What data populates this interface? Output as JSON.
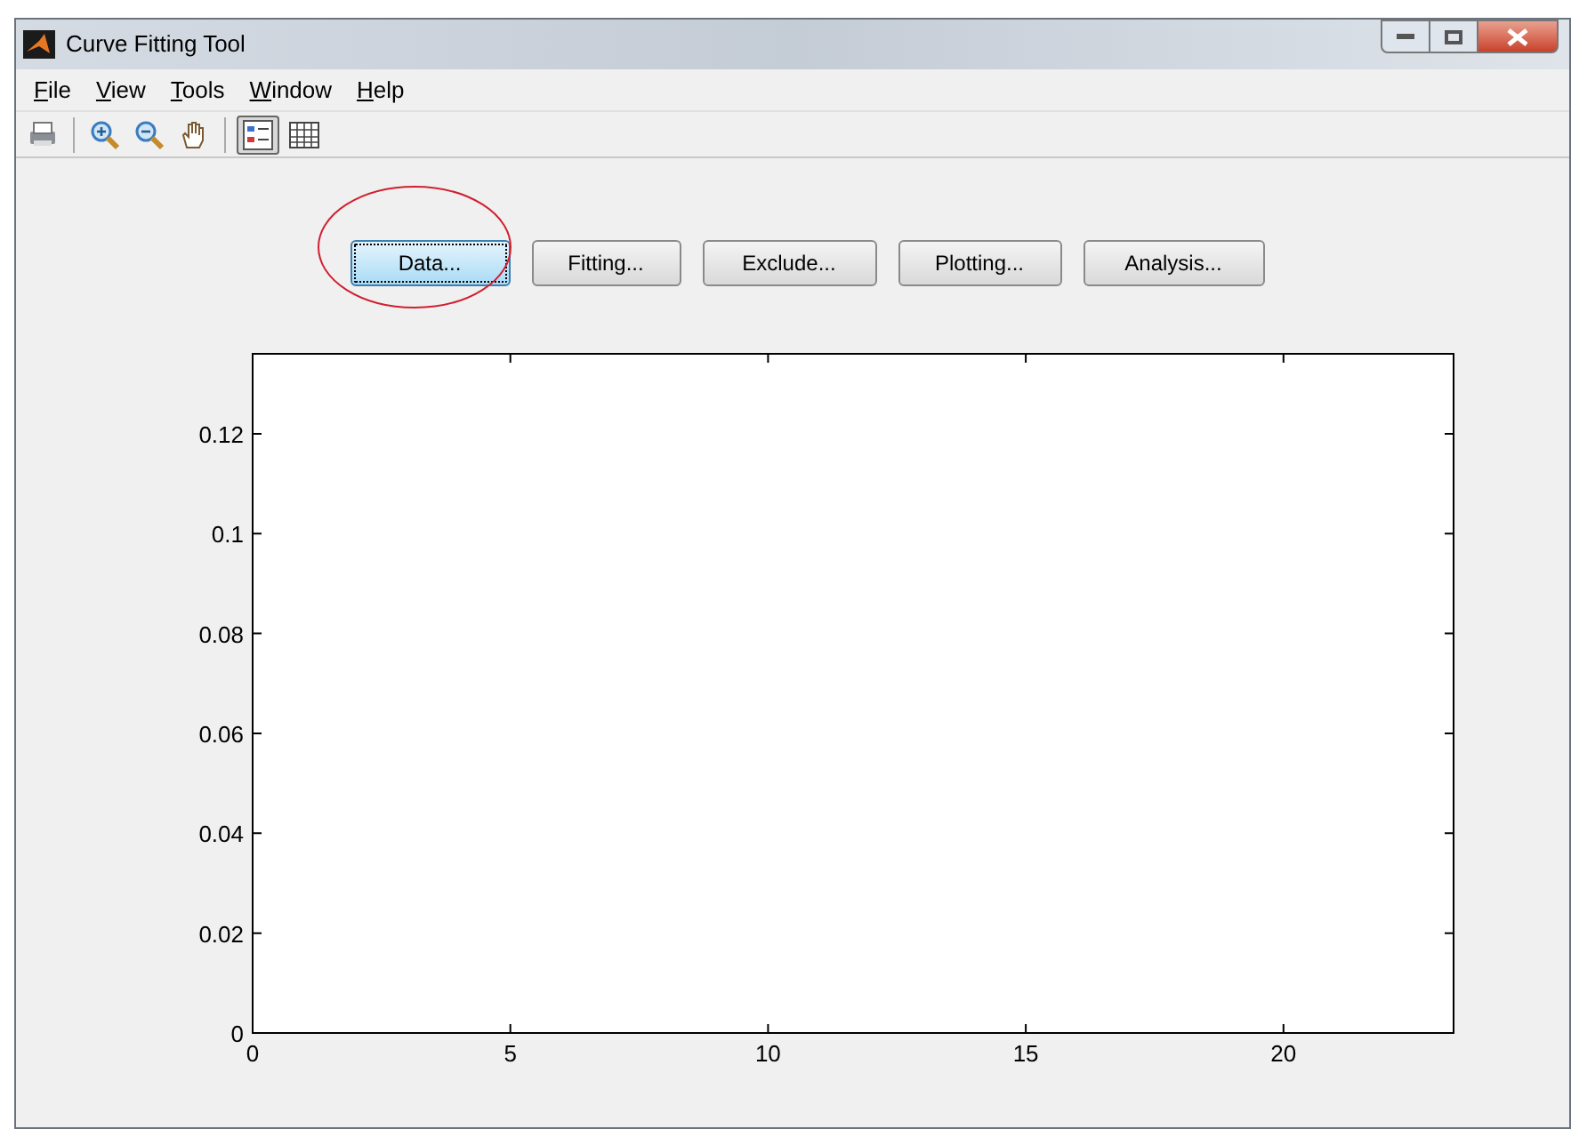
{
  "window": {
    "title": "Curve Fitting Tool"
  },
  "menu": [
    {
      "label": "File"
    },
    {
      "label": "View"
    },
    {
      "label": "Tools"
    },
    {
      "label": "Window"
    },
    {
      "label": "Help"
    }
  ],
  "toolbar": [
    {
      "kind": "print",
      "pressed": false
    },
    {
      "kind": "separator"
    },
    {
      "kind": "zoom-in",
      "pressed": false
    },
    {
      "kind": "zoom-out",
      "pressed": false
    },
    {
      "kind": "pan",
      "pressed": false
    },
    {
      "kind": "separator"
    },
    {
      "kind": "legend",
      "pressed": true
    },
    {
      "kind": "grid",
      "pressed": false
    }
  ],
  "buttons": [
    {
      "label": "Data...",
      "focused": true,
      "circled": true
    },
    {
      "label": "Fitting...",
      "focused": false,
      "circled": false
    },
    {
      "label": "Exclude...",
      "focused": false,
      "circled": false
    },
    {
      "label": "Plotting...",
      "focused": false,
      "circled": false
    },
    {
      "label": "Analysis...",
      "focused": false,
      "circled": false
    }
  ],
  "plot": {
    "chart_data": {
      "type": "line",
      "xlim": [
        0,
        23.3
      ],
      "ylim": [
        0,
        0.136
      ],
      "xticks": [
        0,
        5,
        10,
        15,
        20
      ],
      "yticks": [
        {
          "value": 0,
          "label": "0"
        },
        {
          "value": 0.02,
          "label": "0.02"
        },
        {
          "value": 0.04,
          "label": "0.04"
        },
        {
          "value": 0.06,
          "label": "0.06"
        },
        {
          "value": 0.08,
          "label": "0.08"
        },
        {
          "value": 0.1,
          "label": "0.1"
        },
        {
          "value": 0.12,
          "label": "0.12"
        }
      ]
    }
  }
}
